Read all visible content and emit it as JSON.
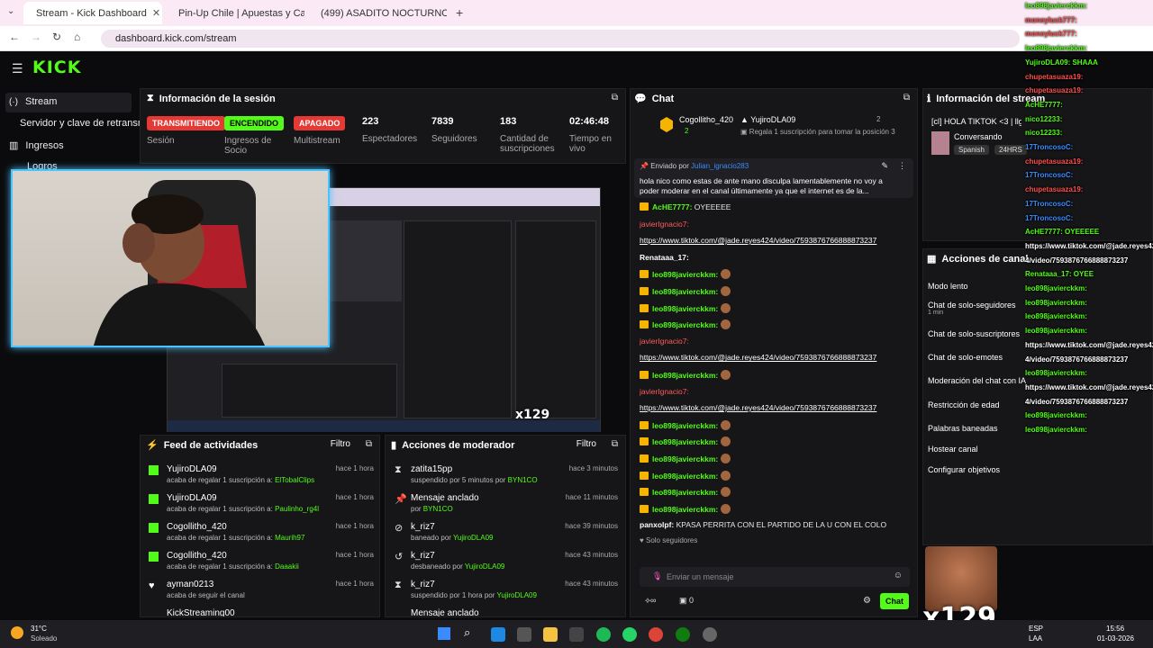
{
  "browser": {
    "tabs": [
      {
        "label": "Stream - Kick Dashboard",
        "active": true
      },
      {
        "label": "Pin-Up Chile | Apuestas y Casin",
        "active": false
      },
      {
        "label": "(499) ASADITO NOCTURNO co",
        "active": false
      }
    ],
    "url": "dashboard.kick.com/stream"
  },
  "kick": {
    "logo": "KICK"
  },
  "sidebar": {
    "items": [
      {
        "label": "Stream"
      },
      {
        "label": "Servidor y clave de retransm"
      },
      {
        "label": "Ingresos"
      },
      {
        "label": "Logros"
      }
    ]
  },
  "session": {
    "title": "Información de la sesión",
    "stats": [
      {
        "value": "TRANSMITIENDO",
        "label": "Sesión",
        "pill": true,
        "color": "#e53935"
      },
      {
        "value": "ENCENDIDO",
        "label": "Ingresos de Socio",
        "pill": true,
        "color": "#53fc18"
      },
      {
        "value": "APAGADO",
        "label": "Multistream",
        "pill": true,
        "color": "#e53935"
      },
      {
        "value": "223",
        "label": "Espectadores"
      },
      {
        "value": "7839",
        "label": "Seguidores"
      },
      {
        "value": "183",
        "label": "Cantidad de suscripciones"
      },
      {
        "value": "02:46:48",
        "label": "Tiempo en vivo"
      }
    ]
  },
  "activity": {
    "title": "Feed de actividades",
    "filter": "Filtro",
    "rows": [
      {
        "name": "YujiroDLA09",
        "action": "acaba de regalar 1 suscripción a:",
        "target": "ElTobalClips",
        "time": "hace 1 hora"
      },
      {
        "name": "YujiroDLA09",
        "action": "acaba de regalar 1 suscripción a:",
        "target": "Paulinho_rg4l",
        "time": "hace 1 hora"
      },
      {
        "name": "Cogollitho_420",
        "action": "acaba de regalar 1 suscripción a:",
        "target": "Maurih97",
        "time": "hace 1 hora"
      },
      {
        "name": "Cogollitho_420",
        "action": "acaba de regalar 1 suscripción a:",
        "target": "Daaakii",
        "time": "hace 1 hora"
      },
      {
        "name": "ayman0213",
        "action": "acaba de seguir el canal",
        "target": "",
        "time": "hace 1 hora"
      },
      {
        "name": "KickStreaming00",
        "action": "",
        "target": "",
        "time": ""
      }
    ]
  },
  "moderator": {
    "title": "Acciones de moderador",
    "filter": "Filtro",
    "rows": [
      {
        "name": "zatita15pp",
        "action": "suspendido por 5 minutos por",
        "target": "BYN1CO",
        "time": "hace 3 minutos"
      },
      {
        "name": "Mensaje anclado",
        "action": "por",
        "target": "BYN1CO",
        "time": "hace 11 minutos"
      },
      {
        "name": "k_riz7",
        "action": "baneado por",
        "target": "YujiroDLA09",
        "time": "hace 39 minutos"
      },
      {
        "name": "k_riz7",
        "action": "desbaneado por",
        "target": "YujiroDLA09",
        "time": "hace 43 minutos"
      },
      {
        "name": "k_riz7",
        "action": "suspendido por 1 hora por",
        "target": "YujiroDLA09",
        "time": "hace 43 minutos"
      },
      {
        "name": "Mensaje anclado",
        "action": "",
        "target": "",
        "time": ""
      }
    ]
  },
  "chat": {
    "title": "Chat",
    "top_gifter_1": "Cogollitho_420",
    "top_gifter_1_count": "2",
    "top_gifter_2": "YujiroDLA09",
    "top_gifter_2_count": "2",
    "gift_prompt": "Regala 1 suscripción para tomar la posición 3",
    "pinned_by_label": "Enviado por",
    "pinned_by_user": "Julian_ignacio283",
    "pinned_text": "hola nico como estas de ante mano disculpa lamentablemente no voy a poder moderar en el canal últimamente ya que el internet es de la...",
    "messages": [
      {
        "user": "AcHE7777:",
        "text": " OYEEEEE",
        "type": "u"
      },
      {
        "user": "javierIgnacio7:",
        "text": "",
        "type": "r"
      },
      {
        "user": "",
        "text": "https://www.tiktok.com/@jade.reyes424/video/7593876766888873237",
        "type": "link"
      },
      {
        "user": "Renataaa_17:",
        "text": "",
        "type": "w"
      },
      {
        "user": "leo898javierckkm:",
        "text": "",
        "type": "e"
      },
      {
        "user": "leo898javierckkm:",
        "text": "",
        "type": "e"
      },
      {
        "user": "leo898javierckkm:",
        "text": "",
        "type": "e"
      },
      {
        "user": "leo898javierckkm:",
        "text": "",
        "type": "e"
      },
      {
        "user": "javierIgnacio7:",
        "text": "",
        "type": "r"
      },
      {
        "user": "",
        "text": "https://www.tiktok.com/@jade.reyes424/video/7593876766888873237",
        "type": "link"
      },
      {
        "user": "leo898javierckkm:",
        "text": "",
        "type": "e"
      },
      {
        "user": "javierIgnacio7:",
        "text": "",
        "type": "r"
      },
      {
        "user": "",
        "text": "https://www.tiktok.com/@jade.reyes424/video/7593876766888873237",
        "type": "link"
      },
      {
        "user": "leo898javierckkm:",
        "text": "",
        "type": "e"
      },
      {
        "user": "leo898javierckkm:",
        "text": "",
        "type": "e"
      },
      {
        "user": "leo898javierckkm:",
        "text": "",
        "type": "e"
      },
      {
        "user": "leo898javierckkm:",
        "text": "",
        "type": "e"
      },
      {
        "user": "leo898javierckkm:",
        "text": "",
        "type": "e"
      },
      {
        "user": "leo898javierckkm:",
        "text": "",
        "type": "e"
      },
      {
        "user": "panxolpf:",
        "text": " KPASA PERRITA CON EL PARTIDO DE LA U CON EL COLO",
        "type": "w"
      }
    ],
    "followers_only": "Solo seguidores",
    "input_placeholder": "Enviar un mensaje",
    "points": "0",
    "send_label": "Chat"
  },
  "stream_info": {
    "title": "Información del stream",
    "stream_title": "[cl] HOLA TIKTOK <3 | llg los lvoces (casino",
    "category": "Conversando",
    "tags": [
      "Spanish",
      "24HRS"
    ]
  },
  "channel_actions": {
    "title": "Acciones de canal",
    "items": [
      {
        "label": "Modo lento",
        "sub": ""
      },
      {
        "label": "Chat de solo-seguidores",
        "sub": "1 min"
      },
      {
        "label": "Chat de solo-suscriptores",
        "sub": ""
      },
      {
        "label": "Chat de solo-emotes",
        "sub": ""
      },
      {
        "label": "Moderación del chat con IA",
        "sub": ""
      },
      {
        "label": "Restricción de edad",
        "sub": ""
      },
      {
        "label": "Palabras baneadas",
        "sub": ""
      },
      {
        "label": "Hostear canal",
        "sub": ""
      },
      {
        "label": "Configurar objetivos",
        "sub": ""
      }
    ]
  },
  "overlay": {
    "combo": "x129",
    "chat": [
      {
        "text": "leo898javierckkm:",
        "color": "#53fc18"
      },
      {
        "text": "moneyluck777:",
        "color": "#ff4d4d"
      },
      {
        "text": "moneyluck777:",
        "color": "#ff4d4d"
      },
      {
        "text": "leo898javierckkm:",
        "color": "#53fc18"
      },
      {
        "text": "YujiroDLA09: SHAAA",
        "color": "#53fc18"
      },
      {
        "text": "chupetasuaza19:",
        "color": "#ff4d4d"
      },
      {
        "text": "chupetasuaza19:",
        "color": "#ff4d4d"
      },
      {
        "text": "AcHE7777:",
        "color": "#53fc18"
      },
      {
        "text": "nico12233:",
        "color": "#53fc18"
      },
      {
        "text": "nico12233:",
        "color": "#53fc18"
      },
      {
        "text": "17TroncosoC:",
        "color": "#3a8bff"
      },
      {
        "text": "chupetasuaza19:",
        "color": "#ff4d4d"
      },
      {
        "text": "17TroncosoC:",
        "color": "#3a8bff"
      },
      {
        "text": "chupetasuaza19:",
        "color": "#ff4d4d"
      },
      {
        "text": "17TroncosoC:",
        "color": "#3a8bff"
      },
      {
        "text": "17TroncosoC:",
        "color": "#3a8bff"
      },
      {
        "text": "AcHE7777: OYEEEEE",
        "color": "#53fc18"
      },
      {
        "text": "https://www.tiktok.com/@jade.reyes42",
        "color": "#ffffff"
      },
      {
        "text": "4/video/7593876766888873237",
        "color": "#ffffff"
      },
      {
        "text": "Renataaa_17: OYEE",
        "color": "#53fc18"
      },
      {
        "text": "leo898javierckkm:",
        "color": "#53fc18"
      },
      {
        "text": "leo898javierckkm:",
        "color": "#53fc18"
      },
      {
        "text": "leo898javierckkm:",
        "color": "#53fc18"
      },
      {
        "text": "leo898javierckkm:",
        "color": "#53fc18"
      },
      {
        "text": "https://www.tiktok.com/@jade.reyes42",
        "color": "#ffffff"
      },
      {
        "text": "4/video/7593876766888873237",
        "color": "#ffffff"
      },
      {
        "text": "leo898javierckkm:",
        "color": "#53fc18"
      },
      {
        "text": "https://www.tiktok.com/@jade.reyes42",
        "color": "#ffffff"
      },
      {
        "text": "4/video/7593876766888873237",
        "color": "#ffffff"
      },
      {
        "text": "leo898javierckkm:",
        "color": "#53fc18"
      },
      {
        "text": "leo898javierckkm:",
        "color": "#53fc18"
      }
    ]
  },
  "taskbar": {
    "temp": "31°C",
    "weather": "Soleado",
    "lang": "ESP",
    "lang2": "LAA",
    "time": "15:56",
    "date": "01-03-2026"
  }
}
